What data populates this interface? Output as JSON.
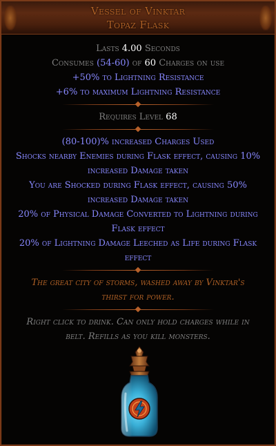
{
  "item": {
    "name": "Vessel of Vinktar",
    "base": "Topaz Flask"
  },
  "properties": {
    "lasts_prefix": "Lasts ",
    "lasts_value": "4.00",
    "lasts_suffix": " Seconds",
    "consumes_prefix": "Consumes ",
    "consumes_value": "(54-60)",
    "consumes_mid": " of ",
    "consumes_max": "60",
    "consumes_suffix": " Charges on use",
    "implicit_1": "+50% to Lightning Resistance",
    "implicit_2": "+6% to maximum Lightning Resistance"
  },
  "requirements": {
    "prefix": "Requires Level ",
    "level": "68"
  },
  "mods": [
    "(80-100)% increased Charges Used",
    "Shocks nearby Enemies during Flask effect, causing 10% increased Damage taken",
    "You are Shocked during Flask effect, causing 50% increased Damage taken",
    "20% of Physical Damage Converted to Lightning during Flask effect",
    "20% of Lightning Damage Leeched as Life during Flask effect"
  ],
  "flavour": "The great city of storms, washed away by Vinktar's thirst for power.",
  "usage_hint": "Right click to drink. Can only hold charges while in belt. Refills as you kill monsters.",
  "colors": {
    "unique_name": "#af6025",
    "magic_mod": "#8888ff",
    "default_text": "#7f7f7f",
    "value_white": "#ffffff",
    "flask_liquid": "#3ab0d8"
  },
  "icons": {
    "flask": "topaz-flask-icon",
    "lightning": "lightning-sigil-icon"
  }
}
